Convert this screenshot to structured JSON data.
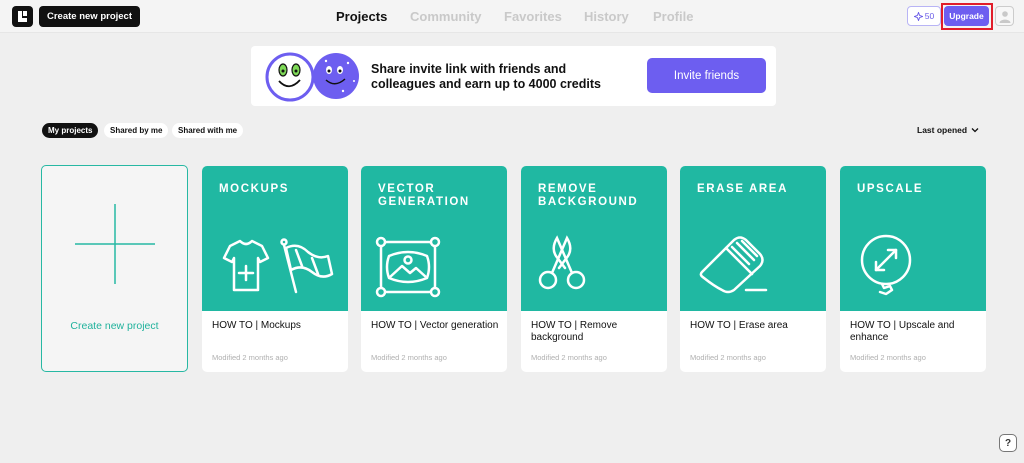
{
  "header": {
    "create_label": "Create new project",
    "nav": [
      {
        "label": "Projects",
        "active": true
      },
      {
        "label": "Community",
        "active": false
      },
      {
        "label": "Favorites",
        "active": false
      },
      {
        "label": "History",
        "active": false
      },
      {
        "label": "Profile",
        "active": false
      }
    ],
    "credits": "50",
    "credits_icon": "sparkle-icon",
    "upgrade_label": "Upgrade",
    "avatar_icon": "user-icon"
  },
  "banner": {
    "text": "Share invite link with friends and colleagues and earn up to 4000 credits",
    "button_label": "Invite friends"
  },
  "filters": {
    "tabs": [
      {
        "label": "My projects",
        "active": true
      },
      {
        "label": "Shared by me",
        "active": false
      },
      {
        "label": "Shared with me",
        "active": false
      }
    ],
    "sort_label": "Last opened"
  },
  "new_project": {
    "label": "Create new project"
  },
  "projects": [
    {
      "thumb_title": "MOCKUPS",
      "title": "HOW TO | Mockups",
      "modified": "Modified 2 months ago",
      "icon": "tshirt-flag-icon"
    },
    {
      "thumb_title": "VECTOR GENERATION",
      "title": "HOW TO | Vector generation",
      "modified": "Modified 2 months ago",
      "icon": "vector-image-icon"
    },
    {
      "thumb_title": "REMOVE BACKGROUND",
      "title": "HOW TO | Remove background",
      "modified": "Modified 2 months ago",
      "icon": "scissors-icon"
    },
    {
      "thumb_title": "ERASE AREA",
      "title": "HOW TO | Erase area",
      "modified": "Modified 2 months ago",
      "icon": "eraser-icon"
    },
    {
      "thumb_title": "UPSCALE",
      "title": "HOW TO | Upscale and enhance",
      "modified": "Modified 2 months ago",
      "icon": "upscale-icon"
    }
  ],
  "help_label": "?",
  "colors": {
    "accent": "#6d5ef0",
    "teal": "#20b8a2",
    "highlight": "#e11d2a"
  }
}
